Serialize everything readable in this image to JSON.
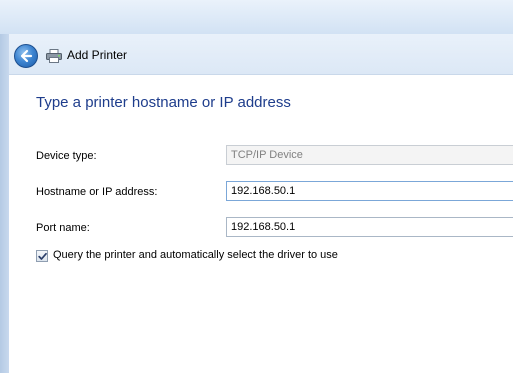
{
  "window": {
    "title": "Add Printer"
  },
  "page": {
    "heading": "Type a printer hostname or IP address"
  },
  "form": {
    "device_type": {
      "label": "Device type:",
      "value": "TCP/IP Device"
    },
    "hostname": {
      "label": "Hostname or IP address:",
      "value": "192.168.50.1"
    },
    "port_name": {
      "label": "Port name:",
      "value": "192.168.50.1"
    },
    "query_driver": {
      "label": "Query the printer and automatically select the driver to use",
      "checked": true
    }
  },
  "icons": {
    "back": "back-arrow-icon",
    "printer": "printer-icon",
    "checkmark": "checkmark-icon"
  },
  "colors": {
    "heading": "#1e3d8c",
    "frame": "#c3d7ee",
    "back_button": "#3f86d2"
  }
}
